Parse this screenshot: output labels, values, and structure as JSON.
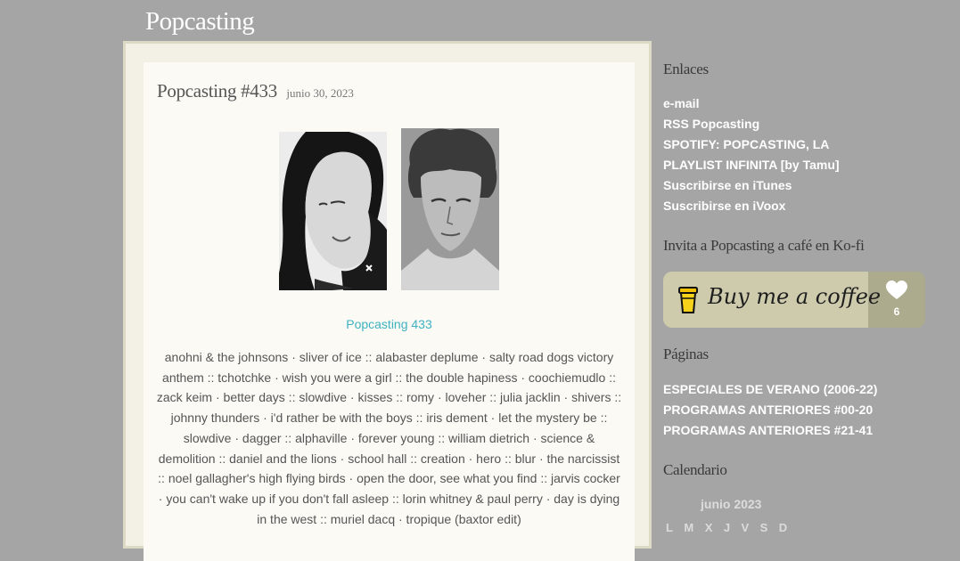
{
  "site": {
    "title": "Popcasting"
  },
  "post": {
    "title": "Popcasting #433",
    "date": "junio 30, 2023",
    "link_label": "Popcasting 433",
    "tracklist": "anohni & the johnsons · sliver of ice :: alabaster deplume · salty road dogs victory anthem :: tchotchke · wish you were a girl :: the double hapiness · coochiemudlo :: zack keim · better days :: slowdive · kisses :: romy · loveher :: julia jacklin · shivers :: johnny thunders · i'd rather be with the boys :: iris dement · let the mystery be :: slowdive · dagger :: alphaville · forever young :: william dietrich · science & demolition :: daniel and the lions · school hall :: creation · hero :: blur · the narcissist :: noel gallagher's high flying birds · open the door, see what you find :: jarvis cocker · you can't wake up if you don't fall asleep :: lorin whitney & paul perry · day is dying in the west :: muriel dacq · tropique (baxtor edit)"
  },
  "sidebar": {
    "enlaces_title": "Enlaces",
    "enlaces": [
      "e-mail",
      "RSS Popcasting",
      "SPOTIFY: POPCASTING, LA PLAYLIST INFINITA [by Tamu]",
      "Suscribirse en iTunes",
      "Suscribirse en iVoox"
    ],
    "kofi_title": "Invita a Popcasting a café en Ko-fi",
    "kofi": {
      "label": "Buy me a coffee",
      "count": "6"
    },
    "paginas_title": "Páginas",
    "paginas": [
      "ESPECIALES DE VERANO (2006-22)",
      "PROGRAMAS ANTERIORES #00-20",
      "PROGRAMAS ANTERIORES #21-41"
    ],
    "calendario_title": "Calendario",
    "calendar": {
      "month": "junio 2023",
      "days": [
        "L",
        "M",
        "X",
        "J",
        "V",
        "S",
        "D"
      ]
    }
  },
  "colors": {
    "background": "#a5a5a5",
    "link_accent": "#3fb2c0",
    "kofi_left": "#cdcbac",
    "kofi_right": "#adab8d"
  }
}
